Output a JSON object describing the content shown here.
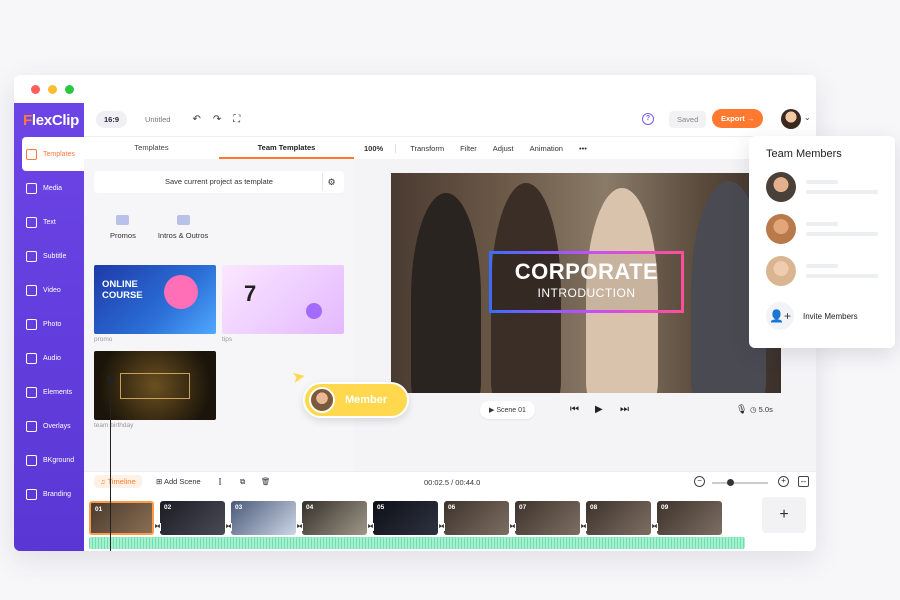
{
  "app": {
    "logo_prefix": "F",
    "logo_rest": "lexClip"
  },
  "sidebar": {
    "items": [
      {
        "label": "Templates",
        "icon": "template-icon",
        "active": true
      },
      {
        "label": "Media",
        "icon": "media-icon"
      },
      {
        "label": "Text",
        "icon": "text-icon"
      },
      {
        "label": "Subtitle",
        "icon": "subtitle-icon"
      },
      {
        "label": "Video",
        "icon": "video-icon"
      },
      {
        "label": "Photo",
        "icon": "photo-icon"
      },
      {
        "label": "Audio",
        "icon": "audio-icon"
      },
      {
        "label": "Elements",
        "icon": "elements-icon"
      },
      {
        "label": "Overlays",
        "icon": "overlays-icon"
      },
      {
        "label": "BKground",
        "icon": "background-icon"
      },
      {
        "label": "Branding",
        "icon": "branding-icon"
      }
    ]
  },
  "topbar": {
    "ratio": "16:9",
    "title": "Untitled",
    "saved": "Saved",
    "export": "Export →"
  },
  "left_panel": {
    "tabs": [
      "Templates",
      "Team Templates"
    ],
    "save_template": "Save current project as template",
    "folders": [
      "Promos",
      "Intros & Outros"
    ],
    "thumbnails": [
      {
        "title": "ONLINE COURSE",
        "caption": "promo"
      },
      {
        "title": "7",
        "caption": "tips"
      },
      {
        "title": "",
        "caption": "team birthday"
      }
    ]
  },
  "preview": {
    "toolbar": {
      "zoom": "100%",
      "items": [
        "Transform",
        "Filter",
        "Adjust",
        "Animation",
        "•••"
      ]
    },
    "title_main": "CORPORATE",
    "title_sub": "INTRODUCTION",
    "scene": "Scene 01",
    "duration": "5.0s"
  },
  "member_tag": {
    "label": "Member"
  },
  "timeline": {
    "tab": "Timeline",
    "add_scene": "Add Scene",
    "timecode": "00:02.5 / 00:44.0",
    "clips": [
      "01",
      "02",
      "03",
      "04",
      "05",
      "06",
      "07",
      "08",
      "09"
    ],
    "add_clip": "+"
  },
  "team_panel": {
    "title": "Team Members",
    "invite": "Invite Members"
  },
  "colors": {
    "accent": "#ff7a30",
    "sidebar": "#6d44e6",
    "member": "#ffd84d"
  }
}
